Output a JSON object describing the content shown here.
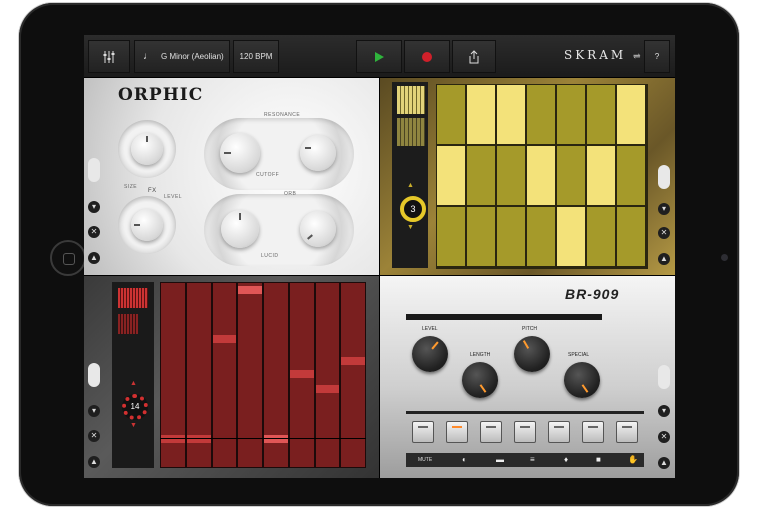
{
  "toolbar": {
    "mixer_icon": "mixer-sliders-icon",
    "scale_label": "G Minor (Aeolian)",
    "tempo_label": "120 BPM",
    "play_icon": "play-icon",
    "record_icon": "record-icon",
    "share_icon": "share-icon",
    "logo_text": "SKRAM",
    "help_label": "?"
  },
  "orphic": {
    "title": "ORPHIC",
    "labels": {
      "resonance": "RESONANCE",
      "cutoff": "CUTOFF",
      "size": "SIZE",
      "fx": "FX",
      "level": "LEVEL",
      "orb": "ORB",
      "lucid": "LUCID"
    }
  },
  "seq_yellow": {
    "step_count": "3",
    "colors": {
      "bright": "#f3e27a",
      "dim": "#a59a2a"
    },
    "grid": [
      [
        0,
        1,
        1,
        0,
        0,
        0,
        1
      ],
      [
        1,
        0,
        0,
        1,
        0,
        1,
        0
      ],
      [
        0,
        0,
        0,
        0,
        1,
        0,
        0
      ]
    ]
  },
  "seq_red": {
    "step_count": "14",
    "colors": {
      "cell": "#7a1f1f",
      "hit": "#c23a3a",
      "active": "#e05656"
    }
  },
  "br909": {
    "title": "BR-909",
    "labels": {
      "level": "LEVEL",
      "pitch": "PITCH",
      "length": "LENGTH",
      "special": "SPECIAL",
      "mute": "MUTE"
    },
    "knob_accent": "#ff9a2e"
  }
}
